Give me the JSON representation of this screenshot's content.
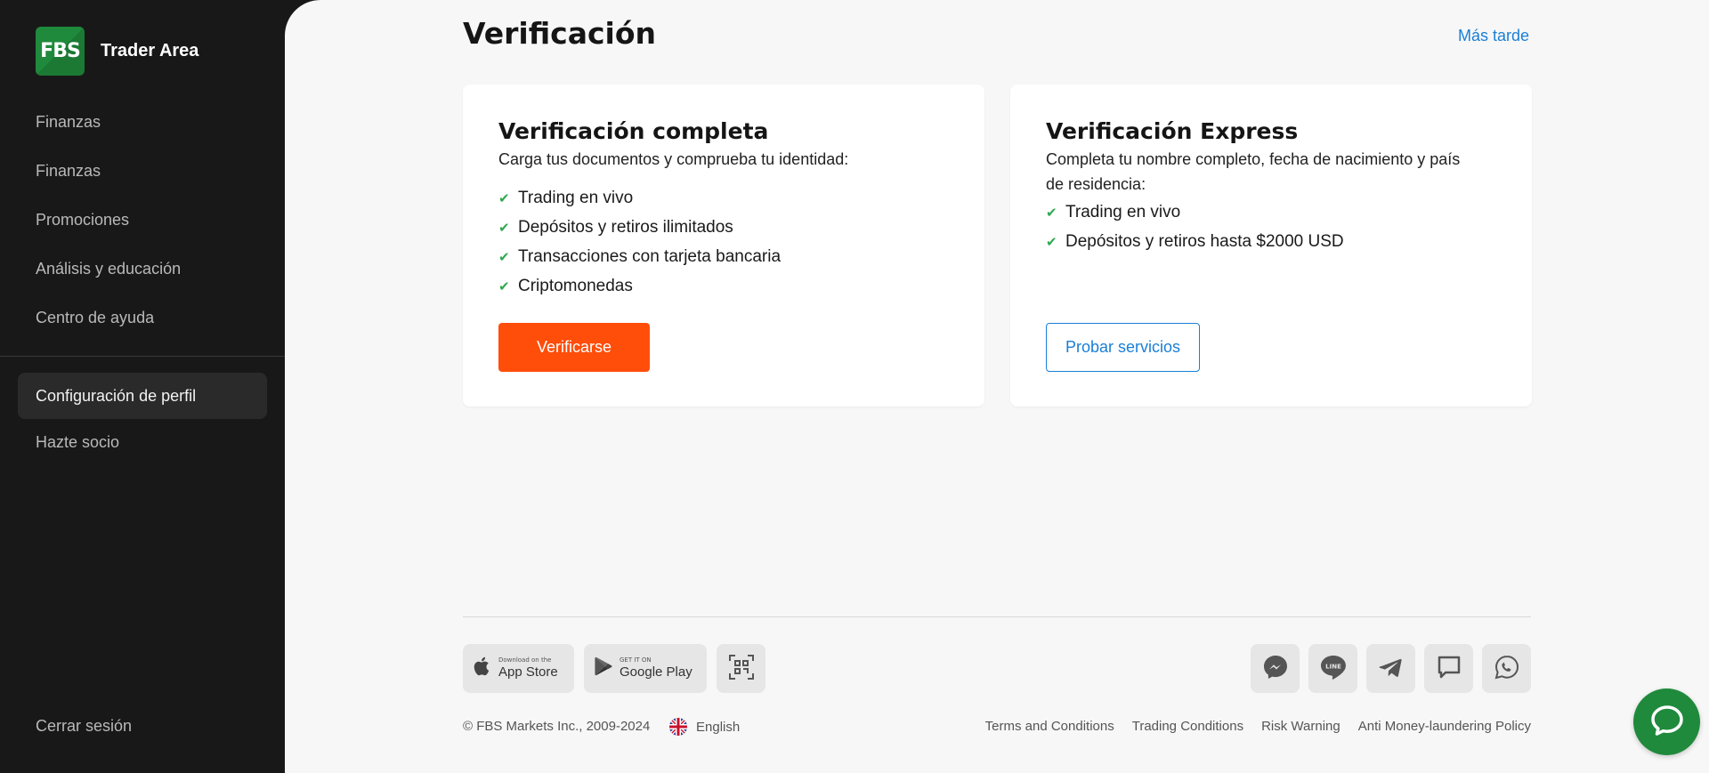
{
  "sidebar": {
    "logo_mark": "FBS",
    "logo_text": "Trader Area",
    "items": [
      {
        "label": "Finanzas"
      },
      {
        "label": "Finanzas"
      },
      {
        "label": "Promociones"
      },
      {
        "label": "Análisis y educación"
      },
      {
        "label": "Centro de ayuda"
      }
    ],
    "secondary_items": [
      {
        "label": "Configuración de perfil",
        "active": true
      },
      {
        "label": "Hazte socio"
      }
    ],
    "logout_label": "Cerrar sesión"
  },
  "header": {
    "title": "Verificación",
    "later_label": "Más tarde"
  },
  "cards": {
    "full": {
      "title": "Verificación completa",
      "subtitle": "Carga tus documentos y comprueba tu identidad:",
      "features": [
        "Trading en vivo",
        "Depósitos y retiros ilimitados",
        "Transacciones con tarjeta bancaria",
        "Criptomonedas"
      ],
      "button_label": "Verificarse"
    },
    "express": {
      "title": "Verificación Express",
      "subtitle": "Completa tu nombre completo, fecha de nacimiento y país de residencia:",
      "features": [
        "Trading en vivo",
        "Depósitos y retiros hasta $2000 USD"
      ],
      "button_label": "Probar servicios"
    }
  },
  "footer": {
    "app_store": {
      "small": "Download on the",
      "big": "App Store",
      "icon": "apple-icon"
    },
    "google_play": {
      "small": "GET IT ON",
      "big": "Google Play",
      "icon": "play-icon"
    },
    "qr_icon": "qr-code-icon",
    "social_icons": [
      "messenger-icon",
      "line-icon",
      "telegram-icon",
      "chat-bubble-icon",
      "whatsapp-icon"
    ],
    "copyright": "© FBS Markets Inc., 2009-2024",
    "language": "English",
    "legal_links": [
      "Terms and Conditions",
      "Trading Conditions",
      "Risk Warning",
      "Anti Money-laundering Policy"
    ]
  },
  "colors": {
    "sidebar_bg": "#181818",
    "accent_orange": "#ff4d0a",
    "link_blue": "#1a7fd6",
    "brand_green": "#1f8a3c",
    "check_green": "#2fa84f"
  }
}
